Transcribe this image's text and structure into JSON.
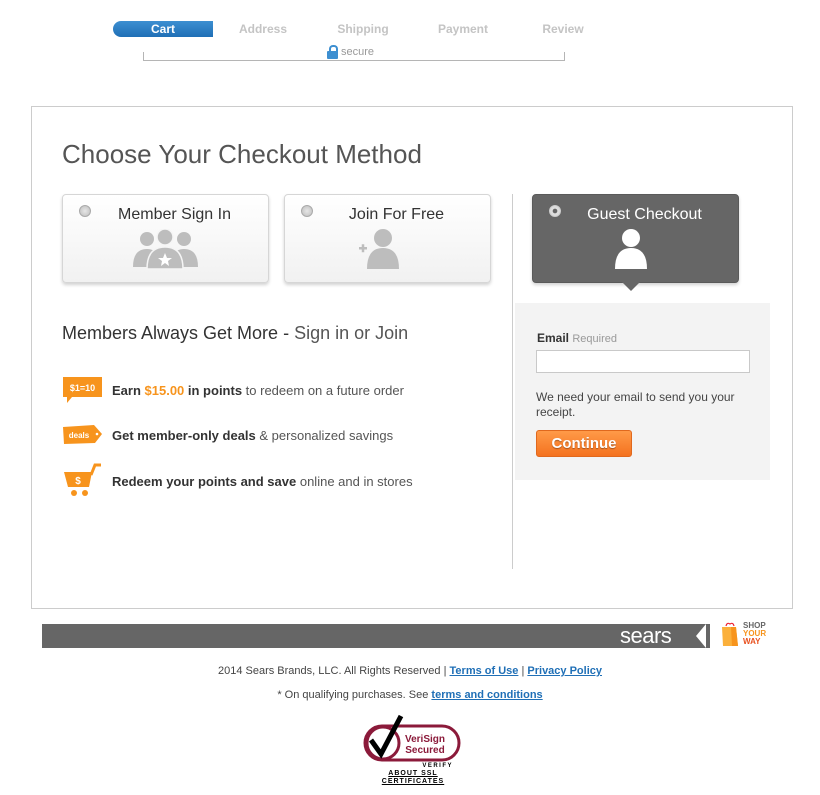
{
  "progress": {
    "steps": [
      {
        "label": "Cart",
        "active": true
      },
      {
        "label": "Address",
        "active": false
      },
      {
        "label": "Shipping",
        "active": false
      },
      {
        "label": "Payment",
        "active": false
      },
      {
        "label": "Review",
        "active": false
      }
    ],
    "secure_label": "secure"
  },
  "main": {
    "title": "Choose Your Checkout Method",
    "options": [
      {
        "label": "Member Sign In",
        "icon": "members-group-icon",
        "selected": false
      },
      {
        "label": "Join For Free",
        "icon": "add-user-icon",
        "selected": false
      },
      {
        "label": "Guest Checkout",
        "icon": "user-icon",
        "selected": true
      }
    ],
    "members": {
      "title_prefix": "Members Always Get More - ",
      "title_link": "Sign in or Join",
      "benefits": [
        {
          "badge": "$1=10",
          "badge_icon": "points-badge-icon",
          "bold_pre": "Earn ",
          "highlight": "$15.00",
          "bold_post": " in points",
          "rest": " to redeem on a future order"
        },
        {
          "badge": "deals",
          "badge_icon": "deals-tag-icon",
          "bold_pre": "Get member-only deals",
          "highlight": "",
          "bold_post": "",
          "rest": " & personalized savings"
        },
        {
          "badge": "$",
          "badge_icon": "cart-dollar-icon",
          "bold_pre": "Redeem your points and save",
          "highlight": "",
          "bold_post": "",
          "rest": " online and in stores"
        }
      ]
    },
    "guest_form": {
      "email_label": "Email",
      "email_required": "Required",
      "email_value": "",
      "email_placeholder": "",
      "note": "We need your email to send you your receipt.",
      "continue_label": "Continue"
    }
  },
  "footer": {
    "brand": "sears",
    "syw_lines": [
      "SHOP",
      "YOUR",
      "WAY"
    ],
    "copyright": "2014 Sears Brands, LLC. All Rights Reserved | ",
    "separator": " | ",
    "terms_of_use": "Terms of Use",
    "privacy_policy": "Privacy Policy",
    "footnote_prefix": "* On qualifying purchases. See ",
    "terms_and_conditions": "terms and conditions",
    "verisign": {
      "line1": "VeriSign",
      "line2": "Secured",
      "verify": "VERIFY",
      "about_line1": "ABOUT SSL",
      "about_line2": "CERTIFICATES"
    }
  },
  "colors": {
    "accent_blue": "#1f6fb6",
    "orange": "#f7941d",
    "guest_dark": "#666666"
  }
}
